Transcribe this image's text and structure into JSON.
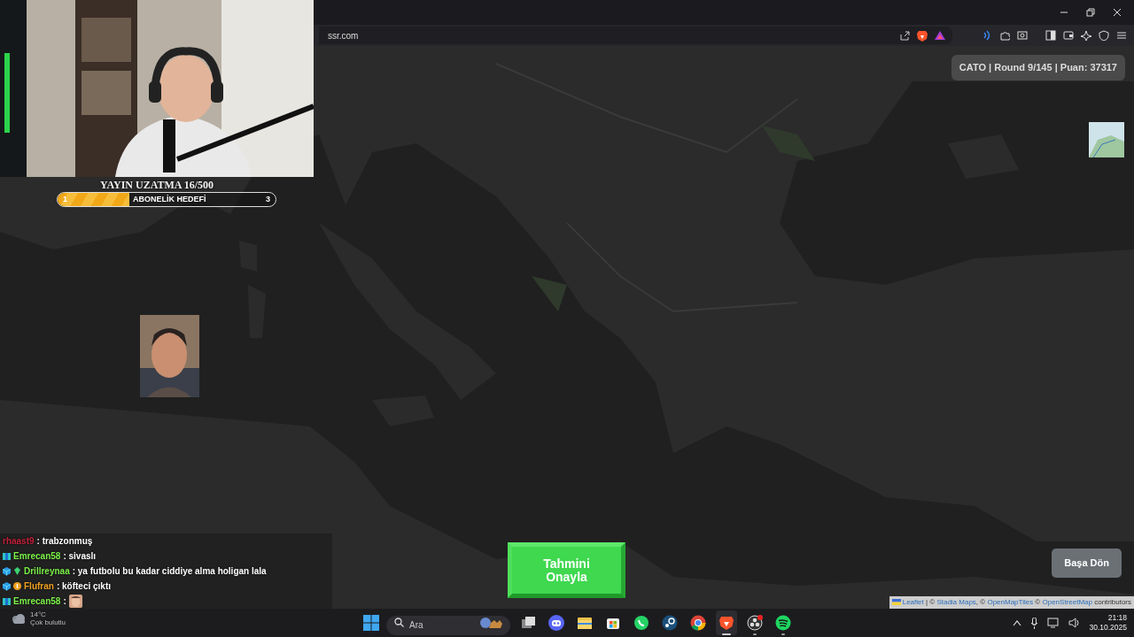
{
  "browser": {
    "url": "ssr.com"
  },
  "webcam": {
    "kind": "picture"
  },
  "stream_overlay": {
    "title": "YAYIN UZATMA 16/500",
    "goal": {
      "label": "ABONELİK HEDEFİ",
      "start": "1",
      "end": "3",
      "level": 0.33
    }
  },
  "map": {
    "kind": "picture"
  },
  "game": {
    "status": "CATO | Round 9/145 | Puan: 37317",
    "confirm_button": "Tahmini Onayla",
    "reset_button": "Başa Dön"
  },
  "portrait": {
    "kind": "picture"
  },
  "attribution": [
    {
      "text": "Leaflet",
      "kind": "link"
    },
    {
      "text": " | © ",
      "kind": "text"
    },
    {
      "text": "Stadia Maps",
      "kind": "link"
    },
    {
      "text": ", © ",
      "kind": "text"
    },
    {
      "text": "OpenMapTiles",
      "kind": "link"
    },
    {
      "text": " © ",
      "kind": "text"
    },
    {
      "text": "OpenStreetMap",
      "kind": "link"
    },
    {
      "text": " contributors",
      "kind": "text"
    }
  ],
  "chat": [
    {
      "user": "rhaast9",
      "color": "#c0203a",
      "text": ": trabzonmuş"
    },
    {
      "user": "Emrecan58",
      "color": "#7cf04a",
      "badges": [
        {
          "kind": "gift"
        }
      ],
      "text": ": sivaslı"
    },
    {
      "user": "Drillreynaa",
      "color": "#7cf04a",
      "badges": [
        {
          "kind": "cube"
        },
        {
          "kind": "gem"
        }
      ],
      "text": ": ya futbolu bu kadar ciddiye alma holigan lala"
    },
    {
      "user": "Flufran",
      "color": "#f0a020",
      "badges": [
        {
          "kind": "cube"
        },
        {
          "kind": "coin"
        }
      ],
      "text": ": köfteci çıktı"
    },
    {
      "user": "Emrecan58",
      "color": "#7cf04a",
      "badges": [
        {
          "kind": "gift"
        }
      ],
      "text": ":",
      "emote": {
        "kind": "picture"
      }
    }
  ],
  "weather": {
    "temperature": "14°C",
    "condition": "Çok bulutlu"
  },
  "taskbar": {
    "search_placeholder": "Ara",
    "apps": [
      {
        "kind": "taskview",
        "selected": false,
        "running": false
      },
      {
        "kind": "discord",
        "selected": false,
        "running": false
      },
      {
        "kind": "files",
        "selected": false,
        "running": false
      },
      {
        "kind": "store",
        "selected": false,
        "running": false
      },
      {
        "kind": "whatsapp",
        "selected": false,
        "running": false
      },
      {
        "kind": "steam",
        "selected": false,
        "running": false
      },
      {
        "kind": "chrome",
        "selected": false,
        "running": false
      },
      {
        "kind": "brave",
        "selected": true,
        "running": true
      },
      {
        "kind": "obs",
        "selected": false,
        "running": true
      },
      {
        "kind": "spotify",
        "selected": false,
        "running": true
      }
    ],
    "time": "21:18",
    "date": "30.10.2025"
  }
}
